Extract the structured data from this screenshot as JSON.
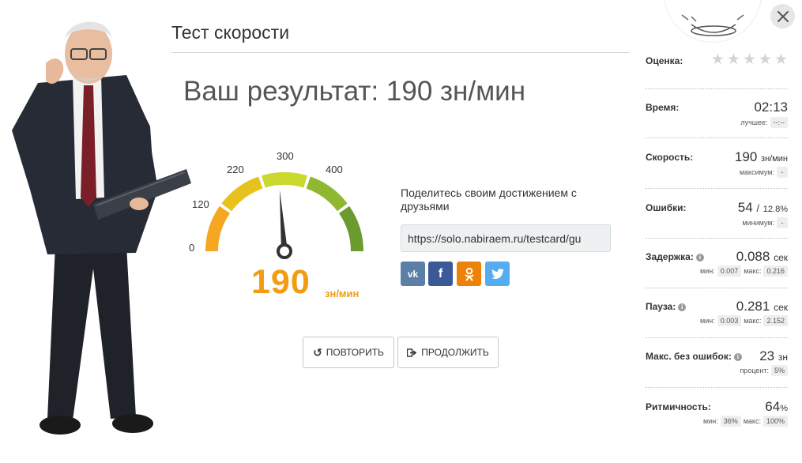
{
  "page": {
    "title": "Тест скорости",
    "result_text": "Ваш результат: 190 зн/мин"
  },
  "gauge": {
    "value": 190,
    "value_text": "190",
    "unit": "зн/мин",
    "min": 0,
    "max": 400,
    "ticks": [
      "0",
      "120",
      "220",
      "300",
      "400"
    ],
    "colors": [
      "#f5a623",
      "#e8c21c",
      "#c9d92e",
      "#8fb832",
      "#6b9b2e"
    ]
  },
  "share": {
    "text": "Поделитесь своим достижением с друзьями",
    "link": "https://solo.nabiraem.ru/testcard/gu",
    "buttons": [
      {
        "name": "vk",
        "glyph": "vk"
      },
      {
        "name": "facebook",
        "glyph": "f"
      },
      {
        "name": "odnoklassniki",
        "glyph": "ok"
      },
      {
        "name": "twitter",
        "glyph": "tw"
      }
    ]
  },
  "actions": {
    "retry_label": "ПОВТОРИТЬ",
    "continue_label": "ПРОДОЛЖИТЬ"
  },
  "stats": {
    "rating": {
      "label": "Оценка:",
      "stars_filled": 0,
      "stars_total": 5
    },
    "time": {
      "label": "Время:",
      "value": "02:13",
      "best_label": "лучшее:",
      "best_value": "--:--"
    },
    "speed": {
      "label": "Скорость:",
      "value": "190",
      "unit": "зн/мин",
      "max_label": "максимум:",
      "max_value": "-"
    },
    "errors": {
      "label": "Ошибки:",
      "value": "54",
      "slash": "/",
      "percent": "12.8%",
      "min_label": "минимум:",
      "min_value": "-"
    },
    "delay": {
      "label": "Задержка:",
      "value": "0.088",
      "unit": "сек",
      "min_label": "мин:",
      "min_value": "0.007",
      "max_label": "макс:",
      "max_value": "0.216"
    },
    "pause": {
      "label": "Пауза:",
      "value": "0.281",
      "unit": "сек",
      "min_label": "мин:",
      "min_value": "0.003",
      "max_label": "макс:",
      "max_value": "2.152"
    },
    "no_errors": {
      "label": "Макс. без ошибок:",
      "value": "23",
      "unit": "зн",
      "percent_label": "процент:",
      "percent_value": "5%"
    },
    "rhythm": {
      "label": "Ритмичность:",
      "value": "64",
      "unit": "%",
      "min_label": "мин:",
      "min_value": "36%",
      "max_label": "макс:",
      "max_value": "100%"
    }
  }
}
